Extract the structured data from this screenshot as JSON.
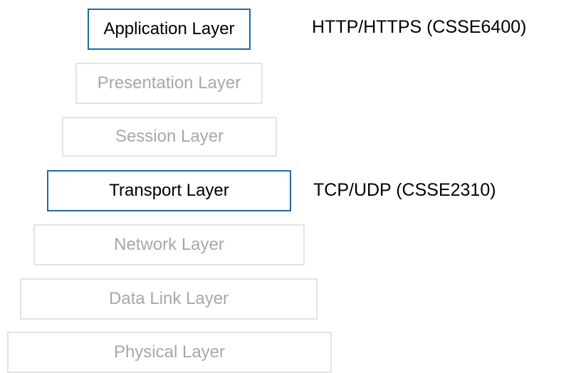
{
  "diagram": {
    "layers": [
      {
        "label": "Application Layer"
      },
      {
        "label": "Presentation Layer"
      },
      {
        "label": "Session Layer"
      },
      {
        "label": "Transport Layer"
      },
      {
        "label": "Network Layer"
      },
      {
        "label": "Data Link Layer"
      },
      {
        "label": "Physical Layer"
      }
    ],
    "annotations": {
      "application": "HTTP/HTTPS (CSSE6400)",
      "transport": "TCP/UDP (CSSE2310)"
    },
    "colors": {
      "highlight_border": "#1f6aa5",
      "faded_border": "#e3e3e3",
      "faded_text": "#a8a8a8"
    }
  }
}
